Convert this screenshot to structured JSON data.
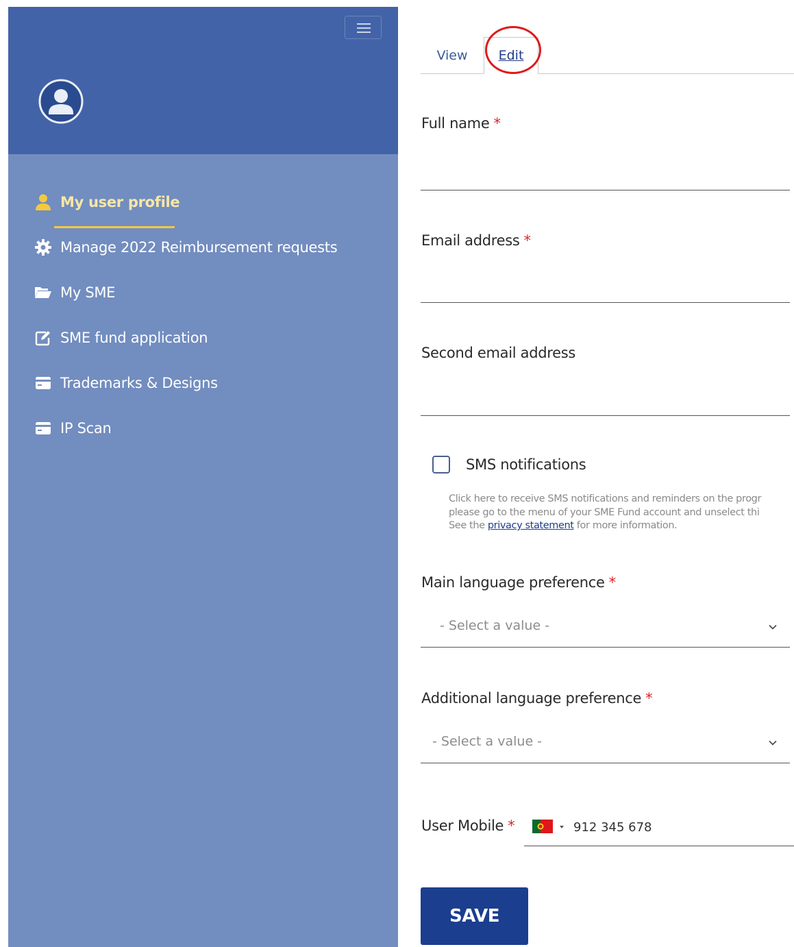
{
  "sidebar": {
    "items": [
      {
        "label": "My user profile",
        "icon": "user-icon",
        "active": true
      },
      {
        "label": "Manage 2022 Reimbursement requests",
        "icon": "gear-icon"
      },
      {
        "label": "My SME",
        "icon": "folder-open-icon"
      },
      {
        "label": "SME fund application",
        "icon": "edit-icon"
      },
      {
        "label": "Trademarks & Designs",
        "icon": "credit-card-icon"
      },
      {
        "label": "IP Scan",
        "icon": "credit-card-icon"
      }
    ],
    "colors": {
      "header": "#4363a8",
      "body": "#728dbf",
      "active_text": "#f6e7a6",
      "active_underline": "#f3c93f"
    }
  },
  "tabs": [
    {
      "label": "View",
      "active": false
    },
    {
      "label": "Edit",
      "active": true
    }
  ],
  "form": {
    "full_name": {
      "label": "Full name",
      "required_mark": "*",
      "value": ""
    },
    "email": {
      "label": "Email address",
      "required_mark": "*",
      "value": ""
    },
    "second_email": {
      "label": "Second email address",
      "value": ""
    },
    "sms": {
      "label": "SMS notifications",
      "checked": false,
      "help_line1": "Click here to receive SMS notifications and reminders on the progr",
      "help_line2": "please go to the menu of your SME Fund account and unselect thi",
      "help_line3_prefix": "See the",
      "help_link": "privacy statement",
      "help_line3_suffix": "for more information."
    },
    "main_language": {
      "label": "Main language preference",
      "required_mark": "*",
      "value": "- Select a value -"
    },
    "additional_language": {
      "label": "Additional language preference",
      "required_mark": "*",
      "value": "- Select a value -"
    },
    "user_mobile": {
      "label": "User Mobile",
      "required_mark": "*",
      "country_flag": "portugal-flag-icon",
      "value": "912 345 678"
    },
    "save_label": "SAVE"
  },
  "colors": {
    "save_button": "#1c3e8f",
    "required": "#d8262b",
    "annotation": "#e01a1a"
  }
}
